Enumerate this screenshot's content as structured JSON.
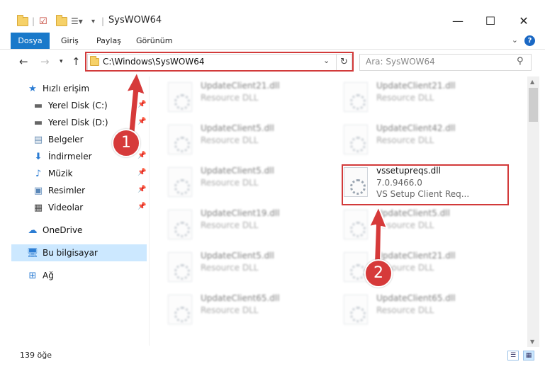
{
  "window": {
    "title": "SysWOW64",
    "controls": {
      "minimize": "—",
      "maximize": "☐",
      "close": "✕"
    }
  },
  "ribbon": {
    "tabs": [
      {
        "label": "Dosya",
        "active": true
      },
      {
        "label": "Giriş"
      },
      {
        "label": "Paylaş"
      },
      {
        "label": "Görünüm"
      }
    ],
    "help": "?"
  },
  "address": {
    "path": "C:\\Windows\\SysWOW64",
    "search_placeholder": "Ara: SysWOW64"
  },
  "navigation": {
    "quick_access": "Hızlı erişim",
    "items": [
      {
        "label": "Yerel Disk (C:)",
        "icon": "drive-icon",
        "pinned": true
      },
      {
        "label": "Yerel Disk (D:)",
        "icon": "drive-icon",
        "pinned": true
      },
      {
        "label": "Belgeler",
        "icon": "documents-icon",
        "pinned": true
      },
      {
        "label": "İndirmeler",
        "icon": "download-icon",
        "pinned": true
      },
      {
        "label": "Müzik",
        "icon": "music-icon",
        "pinned": true
      },
      {
        "label": "Resimler",
        "icon": "pictures-icon",
        "pinned": true
      },
      {
        "label": "Videolar",
        "icon": "videos-icon",
        "pinned": true
      }
    ],
    "onedrive": "OneDrive",
    "this_pc": "Bu bilgisayar",
    "network": "Ağ"
  },
  "files": {
    "left_column": [
      {
        "name": "UpdateClient21.dll",
        "type": "Resource DLL"
      },
      {
        "name": "UpdateClient5.dll",
        "type": "Resource DLL"
      },
      {
        "name": "UpdateClient5.dll",
        "type": "Resource DLL"
      },
      {
        "name": "UpdateClient19.dll",
        "type": "Resource DLL"
      },
      {
        "name": "UpdateClient5.dll",
        "type": "Resource DLL"
      },
      {
        "name": "UpdateClient65.dll",
        "type": "Resource DLL"
      }
    ],
    "right_column": [
      {
        "name": "UpdateClient21.dll",
        "type": "Resource DLL"
      },
      {
        "name": "UpdateClient42.dll",
        "type": "Resource DLL"
      },
      {
        "name": "vssetupreqs.dll",
        "version": "7.0.9466.0",
        "type": "VS Setup Client Req...",
        "highlighted": true
      },
      {
        "name": "UpdateClient5.dll",
        "type": "Resource DLL"
      },
      {
        "name": "UpdateClient21.dll",
        "type": "Resource DLL"
      },
      {
        "name": "UpdateClient65.dll",
        "type": "Resource DLL"
      }
    ]
  },
  "status": {
    "item_count": "139 öğe"
  },
  "annotations": {
    "step1": "1",
    "step2": "2",
    "color": "#d63a3a"
  }
}
